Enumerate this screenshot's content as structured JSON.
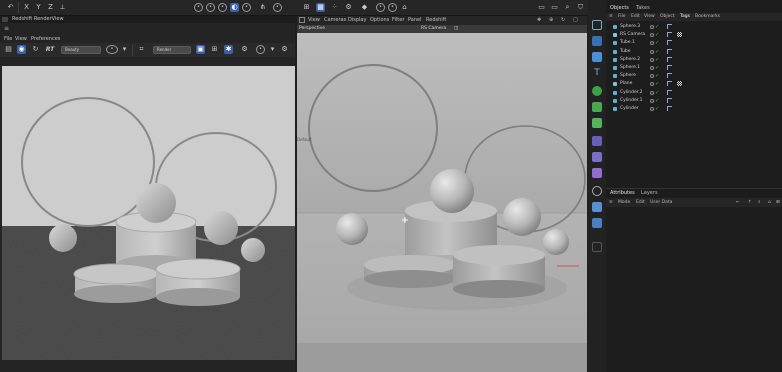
{
  "topbar": {
    "axis_labels": [
      "X",
      "Y",
      "Z"
    ]
  },
  "renderview": {
    "title": "Redshift RenderView",
    "menu": [
      "File",
      "View",
      "Preferences"
    ],
    "mode_dropdown": "Beauty",
    "rt_label": "RT",
    "render_dropdown": "Render"
  },
  "viewport": {
    "menu": [
      "View",
      "Cameras",
      "Display",
      "Options",
      "Filter",
      "Panel",
      "Redshift"
    ],
    "label_left": "Perspective",
    "label_center": "RS Camera",
    "axis_note": "Default"
  },
  "objects_panel": {
    "tabs": [
      "Objects",
      "Takes"
    ],
    "menu": [
      "File",
      "Edit",
      "View",
      "Object",
      "Tags",
      "Bookmarks"
    ],
    "items": [
      {
        "name": "Sphere.3",
        "icon_color": "#5fb0d8"
      },
      {
        "name": "RS Camera",
        "icon_color": "#7fc6e8"
      },
      {
        "name": "Tube.1",
        "icon_color": "#5fb0d8"
      },
      {
        "name": "Tube",
        "icon_color": "#5fb0d8"
      },
      {
        "name": "Sphere.2",
        "icon_color": "#5fb0d8"
      },
      {
        "name": "Sphere.1",
        "icon_color": "#5fb0d8"
      },
      {
        "name": "Sphere",
        "icon_color": "#5fb0d8"
      },
      {
        "name": "Plane",
        "icon_color": "#7ec3e0"
      },
      {
        "name": "Cylinder.2",
        "icon_color": "#5fb0d8"
      },
      {
        "name": "Cylinder.1",
        "icon_color": "#5fb0d8"
      },
      {
        "name": "Cylinder",
        "icon_color": "#5fb0d8"
      }
    ]
  },
  "attributes_panel": {
    "tabs": [
      "Attributes",
      "Layers"
    ],
    "menu": [
      "Mode",
      "Edit",
      "User Data"
    ]
  },
  "colors": {
    "accent_blue": "#3d5fa8",
    "check_green": "#4ec04e",
    "object_icon": "#5fb0d8"
  }
}
